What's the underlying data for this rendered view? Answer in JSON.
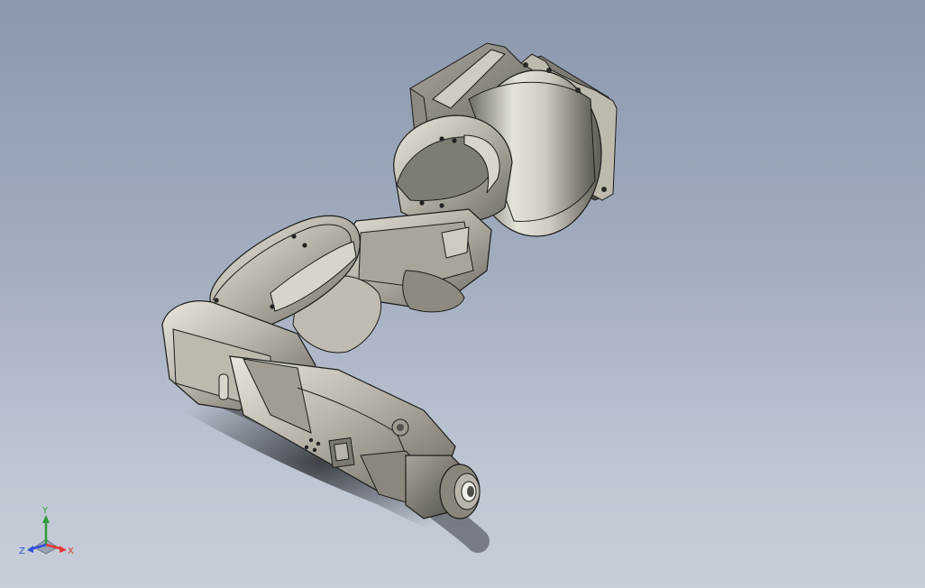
{
  "viewport": {
    "background_top": "#8b98ad",
    "background_bottom": "#c7ced9",
    "model_name": "six-axis-robot-arm"
  },
  "triad": {
    "y_label": "Y",
    "z_label": "Z",
    "x_label": "X",
    "colors": {
      "x": "#e53935",
      "y": "#2e9d3a",
      "z": "#2f4fd8"
    }
  }
}
